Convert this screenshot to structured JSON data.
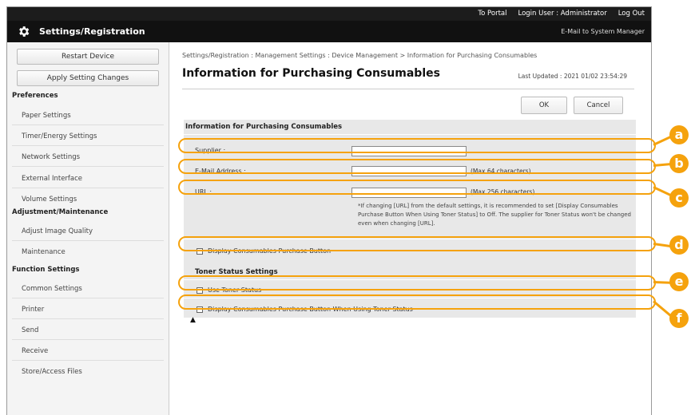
{
  "topbar": {
    "to_portal": "To Portal",
    "login_user": "Login User : Administrator",
    "logout": "Log Out"
  },
  "header": {
    "title": "Settings/Registration",
    "mail_link": "E-Mail to System Manager",
    "icon": "gear-icon"
  },
  "sidebar": {
    "restart_label": "Restart Device",
    "apply_label": "Apply Setting Changes",
    "cat_preferences": "Preferences",
    "item_paper": "Paper Settings",
    "item_timer": "Timer/Energy Settings",
    "item_network": "Network Settings",
    "item_external": "External Interface",
    "item_volume": "Volume Settings",
    "cat_adjust": "Adjustment/Maintenance",
    "item_image": "Adjust Image Quality",
    "item_maintenance": "Maintenance",
    "cat_function": "Function Settings",
    "item_common": "Common Settings",
    "item_printer": "Printer",
    "item_send": "Send",
    "item_receive": "Receive",
    "item_store": "Store/Access Files"
  },
  "main": {
    "breadcrumb": "Settings/Registration : Management Settings : Device Management > Information for Purchasing Consumables",
    "page_title": "Information for Purchasing Consumables",
    "last_updated": "Last Updated : 2021 01/02 23:54:29",
    "ok_label": "OK",
    "cancel_label": "Cancel",
    "section_title": "Information for Purchasing Consumables",
    "supplier_label": "Supplier :",
    "supplier_value": "",
    "email_label": "E-Mail Address :",
    "email_value": "",
    "email_note": "(Max 64 characters)",
    "url_label": "URL :",
    "url_value": "",
    "url_note": "(Max 256 characters)",
    "url_hint": "*If changing [URL] from the default settings, it is recommended to set [Display Consumables Purchase Button When Using Toner Status] to Off. The supplier for Toner Status won't be changed even when changing [URL].",
    "display_button_label": "Display Consumables Purchase Button",
    "toner_section": "Toner Status Settings",
    "use_toner_label": "Use Toner Status",
    "display_toner_label": "Display Consumables Purchase Button When Using Toner Status",
    "to_top": "▲"
  },
  "callouts": {
    "a": "a",
    "b": "b",
    "c": "c",
    "d": "d",
    "e": "e",
    "f": "f"
  },
  "colors": {
    "callout": "#f5a20d",
    "header": "#111111"
  }
}
